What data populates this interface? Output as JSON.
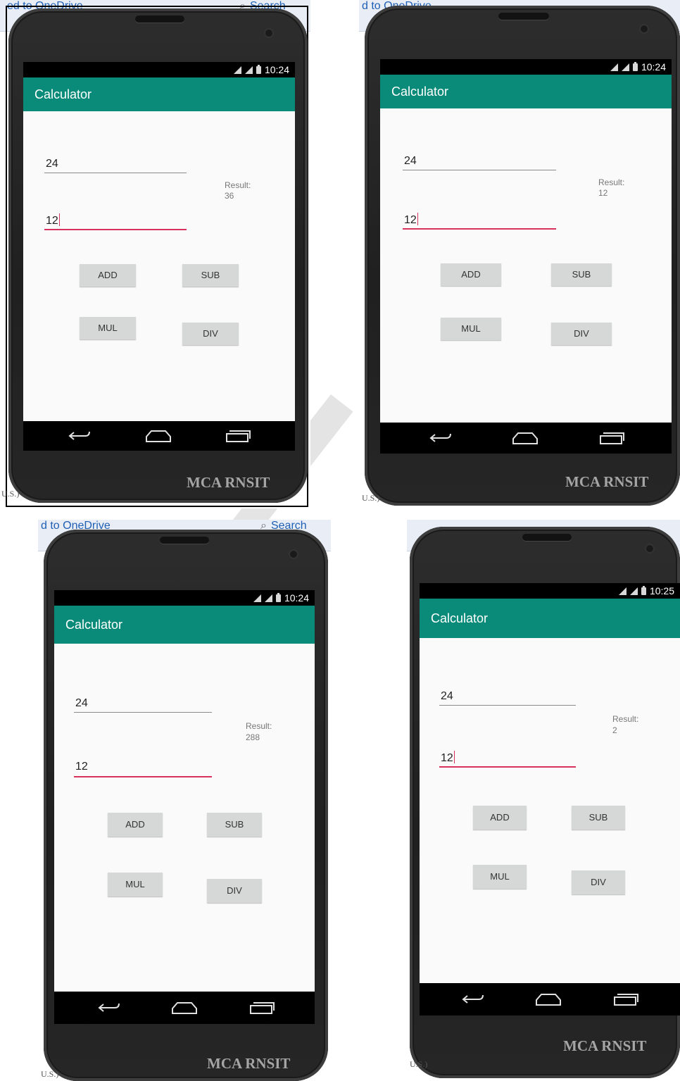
{
  "background": {
    "window_title_fragments": [
      "ed to OneDrive",
      "d to OneDrive",
      "d to OneDrive"
    ],
    "search_label": "Search",
    "footer_text": "U.S.)"
  },
  "watermark": "MCA RNSIT",
  "panels": [
    {
      "status_time": "10:24",
      "app_title": "Calculator",
      "input1": "24",
      "input2": "12",
      "result_label": "Result:",
      "result_value": "36",
      "buttons": {
        "add": "ADD",
        "sub": "SUB",
        "mul": "MUL",
        "div": "DIV"
      }
    },
    {
      "status_time": "10:24",
      "app_title": "Calculator",
      "input1": "24",
      "input2": "12",
      "result_label": "Result:",
      "result_value": "12",
      "buttons": {
        "add": "ADD",
        "sub": "SUB",
        "mul": "MUL",
        "div": "DIV"
      }
    },
    {
      "status_time": "10:24",
      "app_title": "Calculator",
      "input1": "24",
      "input2": "12",
      "result_label": "Result:",
      "result_value": "288",
      "buttons": {
        "add": "ADD",
        "sub": "SUB",
        "mul": "MUL",
        "div": "DIV"
      }
    },
    {
      "status_time": "10:25",
      "app_title": "Calculator",
      "input1": "24",
      "input2": "12",
      "result_label": "Result:",
      "result_value": "2",
      "buttons": {
        "add": "ADD",
        "sub": "SUB",
        "mul": "MUL",
        "div": "DIV"
      }
    }
  ],
  "colors": {
    "app_bar": "#0a8a78",
    "focus_underline": "#d8315b",
    "button": "#d6d7d7",
    "phone_body": "#262626"
  }
}
